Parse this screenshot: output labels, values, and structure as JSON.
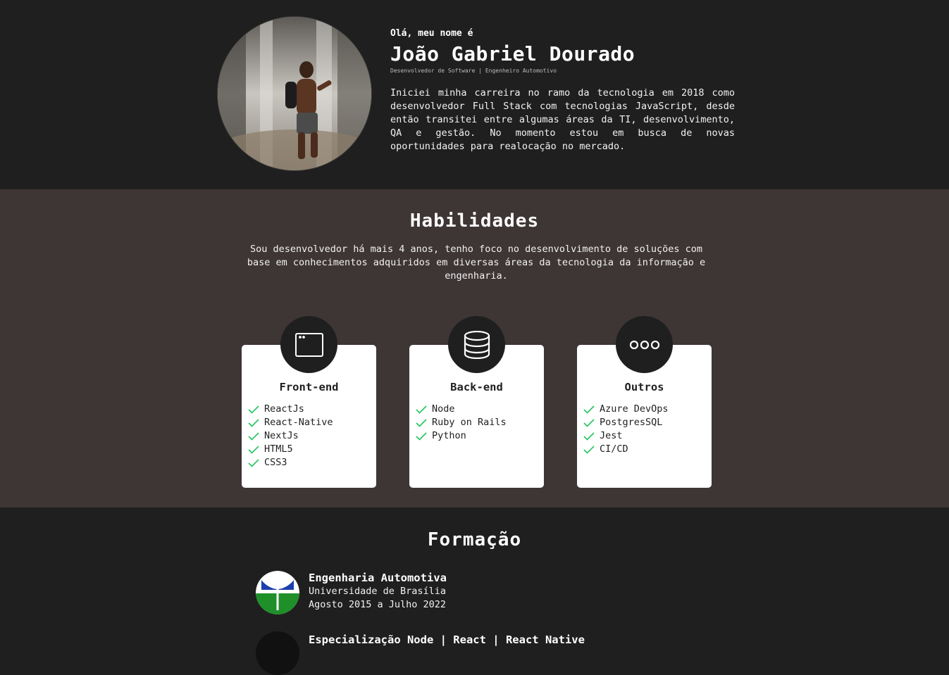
{
  "hero": {
    "greeting": "Olá, meu nome é",
    "name": "João Gabriel Dourado",
    "role": "Desenvolvedor de Software | Engenheiro Automotivo",
    "bio": "Iniciei minha carreira no ramo da tecnologia em 2018 como desenvolvedor Full Stack com tecnologias JavaScript, desde então transitei entre algumas áreas da TI, desenvolvimento, QA e gestão. No momento estou em busca de novas oportunidades para realocação no mercado."
  },
  "skills": {
    "title": "Habilidades",
    "description": "Sou desenvolvedor há mais 4 anos, tenho foco no desenvolvimento de soluções com base em conhecimentos adquiridos em diversas áreas da tecnologia da informação e engenharia.",
    "cards": [
      {
        "icon": "browser-window-icon",
        "title": "Front-end",
        "items": [
          "ReactJs",
          "React-Native",
          "NextJs",
          "HTML5",
          "CSS3"
        ]
      },
      {
        "icon": "database-icon",
        "title": "Back-end",
        "items": [
          "Node",
          "Ruby on Rails",
          "Python"
        ]
      },
      {
        "icon": "dots-icon",
        "title": "Outros",
        "items": [
          "Azure DevOps",
          "PostgresSQL",
          "Jest",
          "CI/CD"
        ]
      }
    ]
  },
  "education": {
    "title": "Formação",
    "items": [
      {
        "course": "Engenharia Automotiva",
        "institution": "Universidade de Brasília",
        "period": "Agosto 2015 a Julho 2022"
      },
      {
        "course": "Especialização Node | React | React Native"
      }
    ]
  },
  "colors": {
    "background": "#1f1f1f",
    "skills_background": "#3e3535",
    "check": "#22c55e",
    "card": "#ffffff"
  }
}
